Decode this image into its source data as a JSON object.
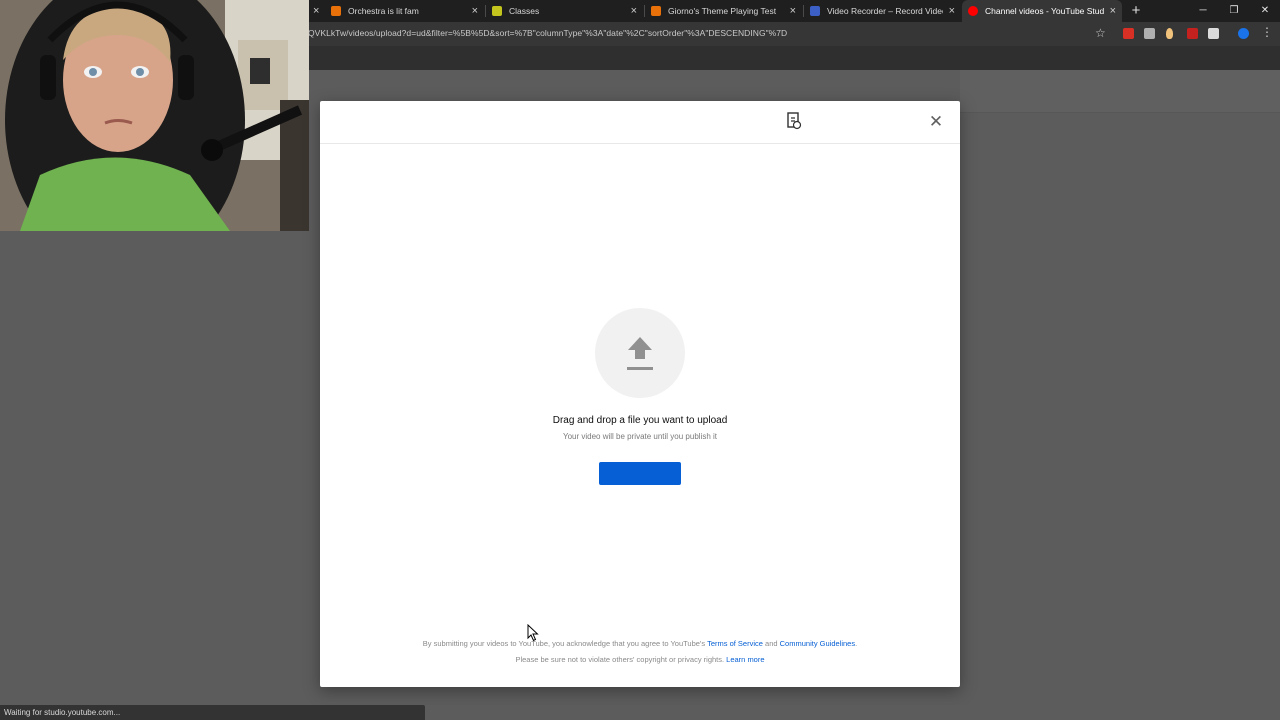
{
  "browser": {
    "tabs": [
      {
        "title": "Orchestra is lit fam",
        "favicon_color": "#e8710a",
        "active": false
      },
      {
        "title": "Classes",
        "favicon_color": "#c3c41d",
        "active": false
      },
      {
        "title": "Giorno's Theme Playing Test",
        "favicon_color": "#e8710a",
        "active": false
      },
      {
        "title": "Video Recorder – Record Video o",
        "favicon_color": "#3b5fc4",
        "active": false
      },
      {
        "title": "Channel videos - YouTube Studio",
        "favicon_color": "#ff0000",
        "active": true
      }
    ],
    "tab_close_glyph": "×",
    "new_tab_glyph": "+",
    "url": "QVKLkTw/videos/upload?d=ud&filter=%5B%5D&sort=%7B\"columnType\"%3A\"date\"%2C\"sortOrder\"%3A\"DESCENDING\"%7D",
    "window_controls": {
      "minimize": "─",
      "restore": "❐",
      "close": "✕"
    }
  },
  "upload_dialog": {
    "close_glyph": "✕",
    "drag_title": "Drag and drop a file you want to upload",
    "drag_subtitle": "Your video will be private until you publish it",
    "select_button_label": "",
    "legal": {
      "line1_text": "By submitting your videos to YouTube, you acknowledge that you agree to YouTube's",
      "terms_link": "Terms of Service",
      "and_text": "and",
      "guidelines_link": "Community Guidelines",
      "period": ".",
      "line2_text": "Please be sure not to violate others' copyright or privacy rights.",
      "learn_more_link": "Learn more"
    },
    "accent_color": "#065fd4"
  },
  "status_bar": {
    "text": "Waiting for studio.youtube.com..."
  }
}
